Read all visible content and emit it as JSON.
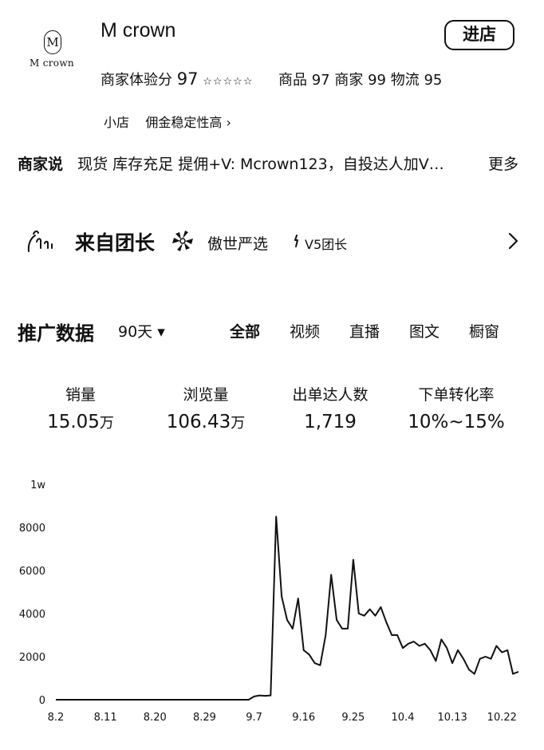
{
  "shop": {
    "logo_text": "M crown",
    "logo_letter": "M",
    "name": "M crown",
    "enter_label": "进店"
  },
  "scores": {
    "experience_label": "商家体验分",
    "experience_value": "97",
    "stars": "☆☆☆☆☆",
    "goods_label": "商品",
    "goods_value": "97",
    "merchant_label": "商家",
    "merchant_value": "99",
    "logistics_label": "物流",
    "logistics_value": "95"
  },
  "tags": {
    "type": "小店",
    "commission": "佣金稳定性高 ›"
  },
  "merchant_says": {
    "label": "商家说",
    "text": "现货 库存充足 提佣+V: Mcrown123，自投达人加V…",
    "more": "更多"
  },
  "leader": {
    "title": "来自团长",
    "team_name": "傲世严选",
    "level": "V5团长"
  },
  "promotion": {
    "title": "推广数据",
    "period": "90天",
    "period_arrow": "▾",
    "tabs": [
      "全部",
      "视频",
      "直播",
      "图文",
      "橱窗"
    ],
    "active_tab": 0
  },
  "stats": [
    {
      "label": "销量",
      "value": "15.05",
      "unit": "万"
    },
    {
      "label": "浏览量",
      "value": "106.43",
      "unit": "万"
    },
    {
      "label": "出单达人数",
      "value": "1,719",
      "unit": ""
    },
    {
      "label": "下单转化率",
      "value": "10%~15%",
      "unit": ""
    }
  ],
  "chart_data": {
    "type": "line",
    "ylim": [
      0,
      10000
    ],
    "y_ticks": [
      0,
      2000,
      4000,
      6000,
      8000,
      10000
    ],
    "y_tick_labels": [
      "0",
      "2000",
      "4000",
      "6000",
      "8000",
      "1w"
    ],
    "x_tick_labels": [
      "8.2",
      "8.11",
      "8.20",
      "8.29",
      "9.7",
      "9.16",
      "9.25",
      "10.4",
      "10.13",
      "10.22"
    ],
    "x_tick_day_index": [
      0,
      9,
      18,
      27,
      36,
      45,
      54,
      63,
      72,
      81
    ],
    "grid": false,
    "series": [
      {
        "values": [
          0,
          0,
          0,
          0,
          0,
          0,
          0,
          0,
          0,
          0,
          0,
          0,
          0,
          0,
          0,
          0,
          0,
          0,
          0,
          0,
          0,
          0,
          0,
          0,
          0,
          0,
          0,
          0,
          0,
          0,
          0,
          0,
          0,
          0,
          0,
          0,
          150,
          200,
          180,
          200,
          8500,
          4800,
          3700,
          3300,
          4700,
          2300,
          2100,
          1700,
          1600,
          3000,
          5800,
          3700,
          3300,
          3300,
          6500,
          4000,
          3900,
          4200,
          3900,
          4300,
          3600,
          3000,
          3000,
          2400,
          2600,
          2700,
          2500,
          2600,
          2300,
          1800,
          2800,
          2400,
          1700,
          2300,
          1900,
          1400,
          1200,
          1900,
          2000,
          1900,
          2500,
          2200,
          2300,
          1200,
          1300
        ]
      }
    ]
  }
}
